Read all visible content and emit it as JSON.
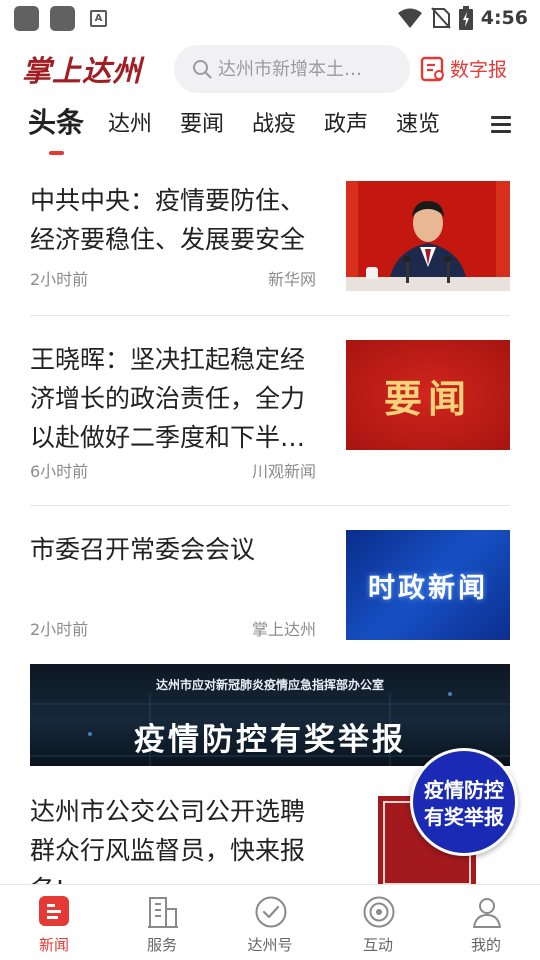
{
  "status_bar": {
    "time": "4:56"
  },
  "header": {
    "logo": "掌上达州",
    "search_placeholder": "达州市新增本土…",
    "digital_label": "数字报"
  },
  "tabs": [
    {
      "label": "头条",
      "active": true
    },
    {
      "label": "达州"
    },
    {
      "label": "要闻"
    },
    {
      "label": "战疫"
    },
    {
      "label": "政声"
    },
    {
      "label": "速览"
    }
  ],
  "news": [
    {
      "title": "中共中央：疫情要防住、经济要稳住、发展要安全",
      "time": "2小时前",
      "source": "新华网"
    },
    {
      "title": "王晓晖：坚决扛起稳定经济增长的政治责任，全力以赴做好二季度和下半…",
      "time": "6小时前",
      "source": "川观新闻",
      "thumb_text": "要闻"
    },
    {
      "title": "市委召开常委会会议",
      "time": "2小时前",
      "source": "掌上达州",
      "thumb_text": "时政新闻"
    },
    {
      "title": "达州市公交公司公开选聘群众行风监督员，快来报名!"
    }
  ],
  "banner": {
    "subtitle": "达州市应对新冠肺炎疫情应急指挥部办公室",
    "title": "疫情防控有奖举报"
  },
  "float_badge": {
    "line1": "疫情防控",
    "line2": "有奖举报"
  },
  "thumb_logo": "掌上达州",
  "bottom_nav": [
    {
      "label": "新闻",
      "icon": "news-icon",
      "active": true
    },
    {
      "label": "服务",
      "icon": "building-icon"
    },
    {
      "label": "达州号",
      "icon": "check-circle-icon"
    },
    {
      "label": "互动",
      "icon": "target-icon"
    },
    {
      "label": "我的",
      "icon": "user-icon"
    }
  ],
  "colors": {
    "accent": "#e53935",
    "logo": "#a21d23",
    "badge": "#1a2ab5"
  }
}
